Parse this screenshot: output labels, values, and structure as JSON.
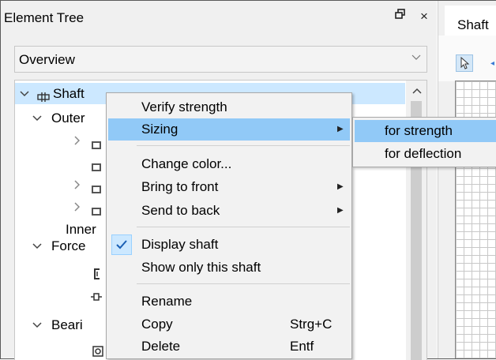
{
  "panel": {
    "title": "Element Tree",
    "float_icon": "float-window-icon",
    "close_glyph": "×",
    "overview": "Overview"
  },
  "tree": {
    "items": [
      {
        "label": "Shaft",
        "selected": true
      },
      {
        "label": "Outer"
      },
      {
        "label": ""
      },
      {
        "label": ""
      },
      {
        "label": ""
      },
      {
        "label": ""
      },
      {
        "label": "Inner"
      },
      {
        "label": "Force"
      },
      {
        "label": ""
      },
      {
        "label": ""
      },
      {
        "label": "Beari"
      },
      {
        "label": ""
      }
    ]
  },
  "right_panel": {
    "tab": "Shaft"
  },
  "context_menu": {
    "items": [
      {
        "label": "Verify strength"
      },
      {
        "label": "Sizing",
        "submenu": true,
        "highlighted": true
      },
      {
        "label": "Change color..."
      },
      {
        "label": "Bring to front",
        "submenu": true
      },
      {
        "label": "Send to back",
        "submenu": true
      },
      {
        "label": "Display shaft",
        "checked": true
      },
      {
        "label": "Show only this shaft"
      },
      {
        "label": "Rename"
      },
      {
        "label": "Copy",
        "shortcut": "Strg+C"
      },
      {
        "label": "Delete",
        "shortcut": "Entf"
      }
    ]
  },
  "sizing_submenu": {
    "items": [
      {
        "label": "for strength",
        "highlighted": true
      },
      {
        "label": "for deflection"
      }
    ]
  },
  "colors": {
    "selection": "#cce8ff",
    "menu_highlight": "#91c9f7",
    "panel_bg": "#f0f0f0"
  }
}
